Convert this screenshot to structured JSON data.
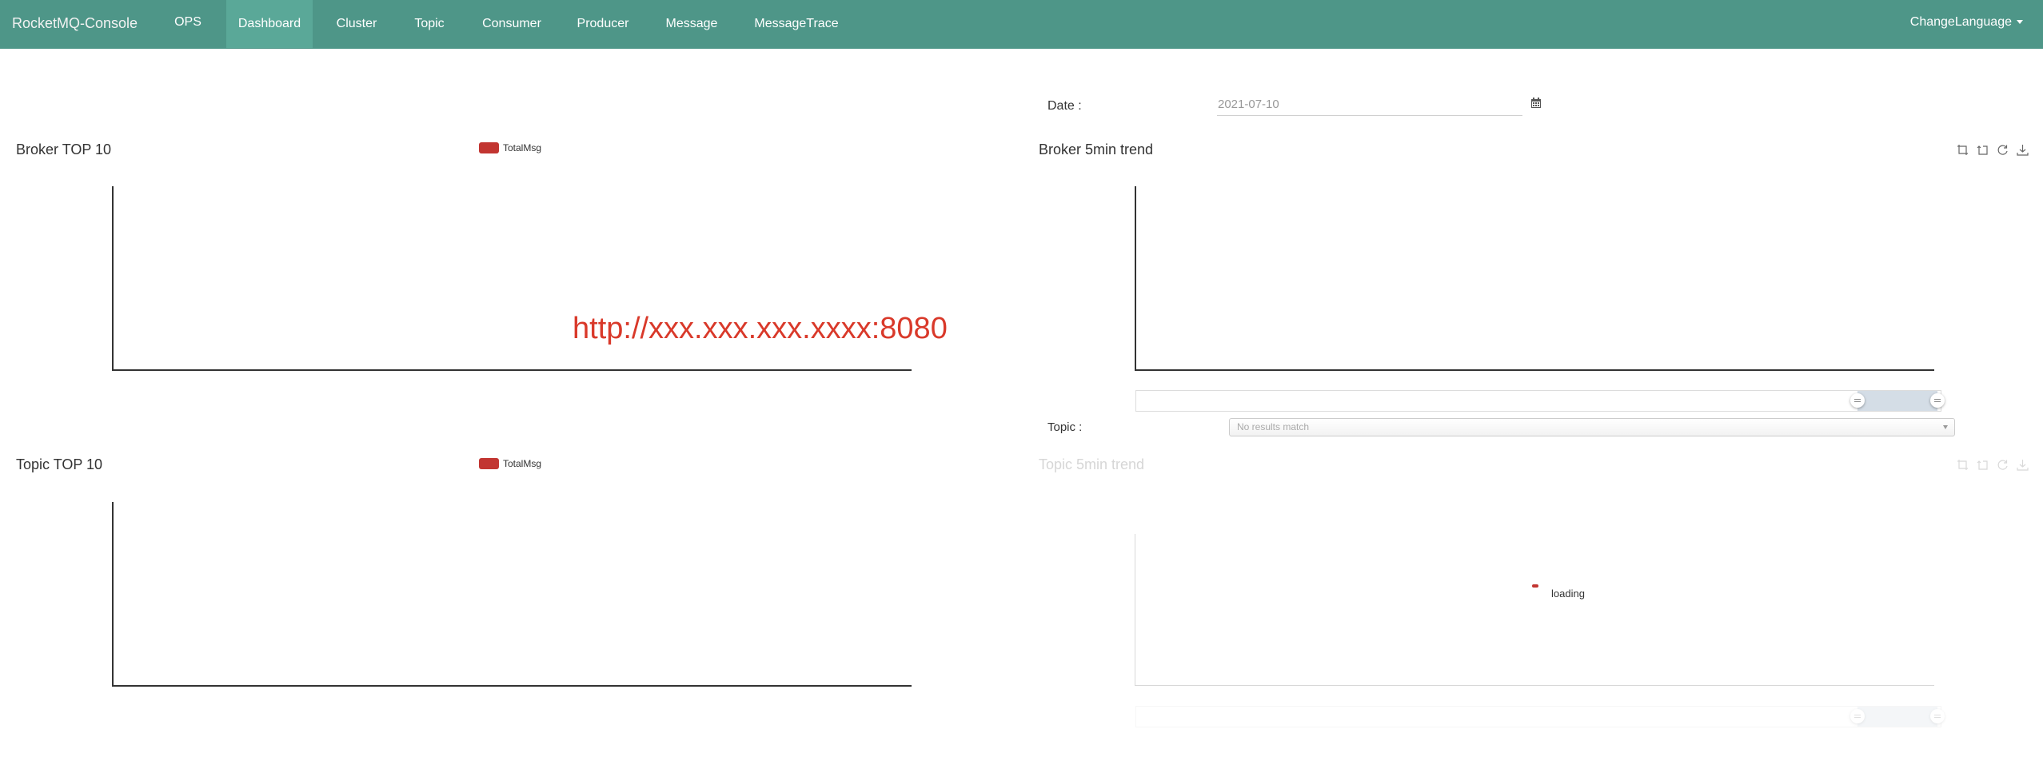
{
  "app": {
    "brand": "RocketMQ-Console"
  },
  "nav": {
    "ops": "OPS",
    "items": [
      {
        "label": "Dashboard",
        "active": true
      },
      {
        "label": "Cluster"
      },
      {
        "label": "Topic"
      },
      {
        "label": "Consumer"
      },
      {
        "label": "Producer"
      },
      {
        "label": "Message"
      },
      {
        "label": "MessageTrace"
      }
    ],
    "language": "ChangeLanguage"
  },
  "filters": {
    "date_label": "Date :",
    "date_value": "2021-07-10",
    "topic_label": "Topic :",
    "topic_placeholder": "No results match"
  },
  "charts": {
    "broker_top": {
      "title": "Broker TOP 10",
      "legend": "TotalMsg"
    },
    "broker_trend": {
      "title": "Broker 5min trend"
    },
    "topic_top": {
      "title": "Topic TOP 10",
      "legend": "TotalMsg"
    },
    "topic_trend": {
      "title": "Topic 5min trend",
      "loading": "loading"
    }
  },
  "overlay": {
    "url": "http://xxx.xxx.xxx.xxxx:8080"
  },
  "colors": {
    "navbar": "#4e9688",
    "nav_active": "#5aa898",
    "series": "#c23531",
    "overlay_text": "#d9392a"
  }
}
